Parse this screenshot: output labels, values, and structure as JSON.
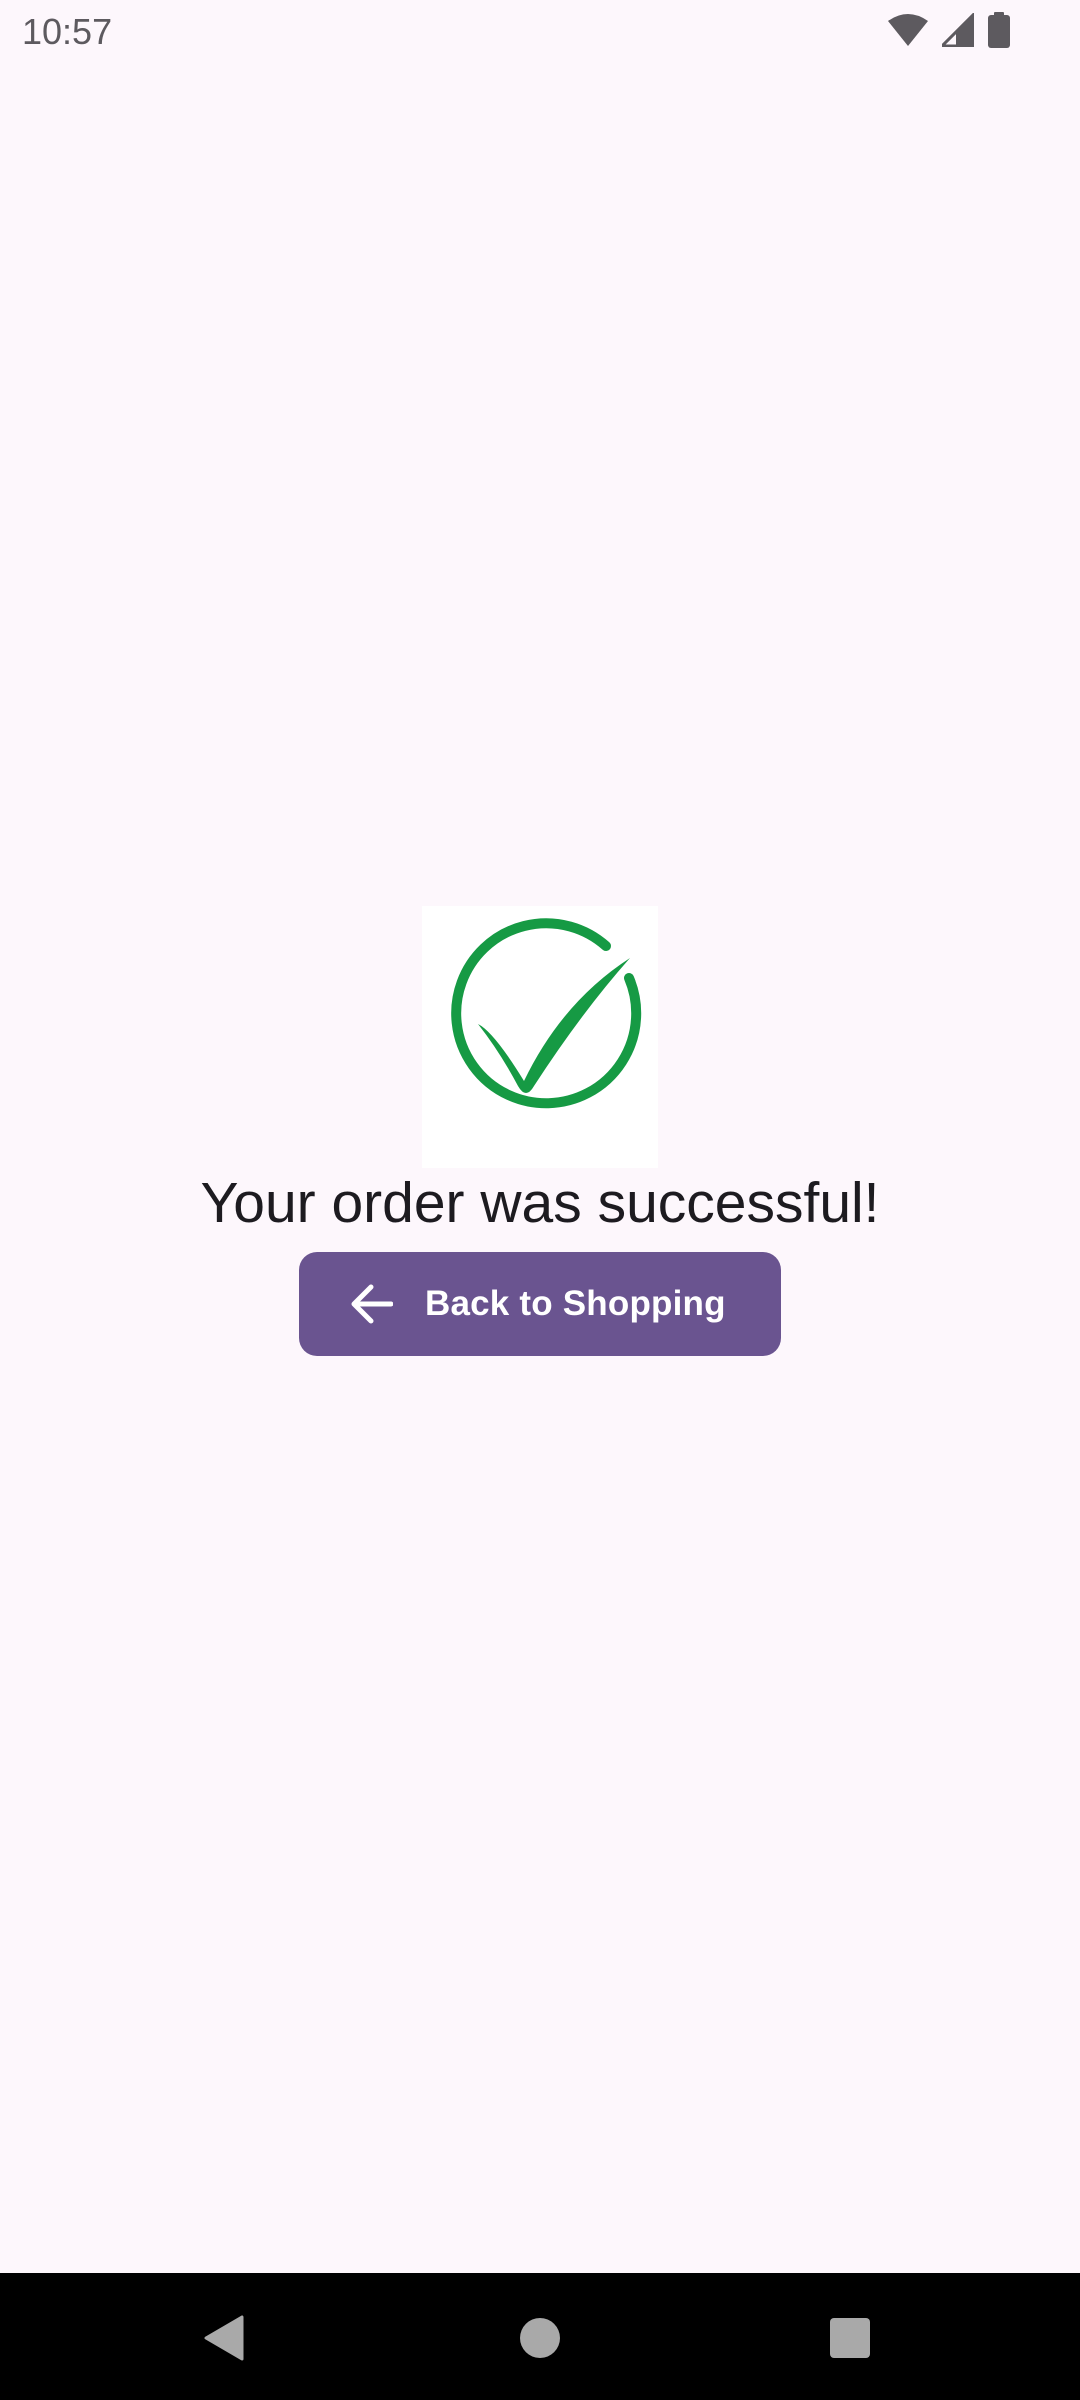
{
  "status_bar": {
    "time": "10:57",
    "icons": [
      "wifi-icon",
      "signal-icon",
      "battery-icon"
    ]
  },
  "content": {
    "success_icon": "check-circle-icon",
    "message": "Your order was successful!",
    "back_button": {
      "label": "Back to Shopping",
      "icon": "arrow-left-icon"
    }
  },
  "navigation_bar": {
    "items": [
      "back-icon",
      "home-icon",
      "recents-icon"
    ]
  },
  "colors": {
    "background": "#FDF7FC",
    "primary": "#6A5490",
    "success_green": "#169A44",
    "text": "#1D1B20"
  }
}
